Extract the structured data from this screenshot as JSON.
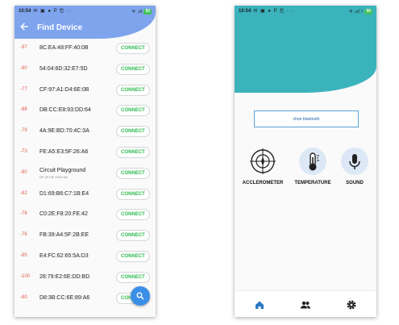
{
  "left_screen": {
    "status_bar": {
      "time": "10:54",
      "icons": "✉ ▣ ● P ⎗ ···",
      "signal": "✳ .ııl",
      "battery": "50"
    },
    "title": "Find Device",
    "back_icon": "arrow-left-icon",
    "connect_label": "CONNECT",
    "devices": [
      {
        "rssi": "-97",
        "name": "8C:EA:48:FF:40:0B"
      },
      {
        "rssi": "-90",
        "name": "54:04:6D:32:E7:5D"
      },
      {
        "rssi": "-77",
        "name": "CF:97:A1:D4:6E:0B"
      },
      {
        "rssi": "-88",
        "name": "DB:CC:E8:93:DD:64"
      },
      {
        "rssi": "-79",
        "name": "4A:9E:BD:70:4C:3A"
      },
      {
        "rssi": "-73",
        "name": "FE:A5:E3:5F:26:A6"
      },
      {
        "rssi": "-80",
        "name": "Circuit Playground",
        "sub": "DF:2F:FB:75:83:D6"
      },
      {
        "rssi": "-82",
        "name": "D1:69:B6:C7:1B:E4"
      },
      {
        "rssi": "-76",
        "name": "C0:2E:F8:20:FE:42"
      },
      {
        "rssi": "-76",
        "name": "FB:39:A4:5F:2B:EE"
      },
      {
        "rssi": "-85",
        "name": "E4:FC:62:65:5A:D3"
      },
      {
        "rssi": "-100",
        "name": "28:79:E2:6E:DD:BD"
      },
      {
        "rssi": "-80",
        "name": "D8:3B:CC:6E:89:A6"
      }
    ],
    "fab_icon": "search-icon",
    "accent": "#7ea4ee",
    "rssi_color": "#e05b4b",
    "connect_color": "#2fbb4f"
  },
  "right_screen": {
    "status_bar": {
      "time": "10:54",
      "icons": "✉ ▣ ● P ⎗ ···",
      "signal": "✳ .ııl ⌇",
      "battery": "50"
    },
    "bluetooth_button": "chọn bluetooth",
    "sensors": [
      {
        "label": "ACCLEROMETER",
        "icon": "compass-icon"
      },
      {
        "label": "TEMPERATURE",
        "icon": "thermometer-icon"
      },
      {
        "label": "SOUND",
        "icon": "microphone-icon"
      }
    ],
    "nav": [
      "home-icon",
      "people-icon",
      "settings-icon"
    ],
    "header_color": "#3bb3bd",
    "nav_active_color": "#2a78c2"
  }
}
